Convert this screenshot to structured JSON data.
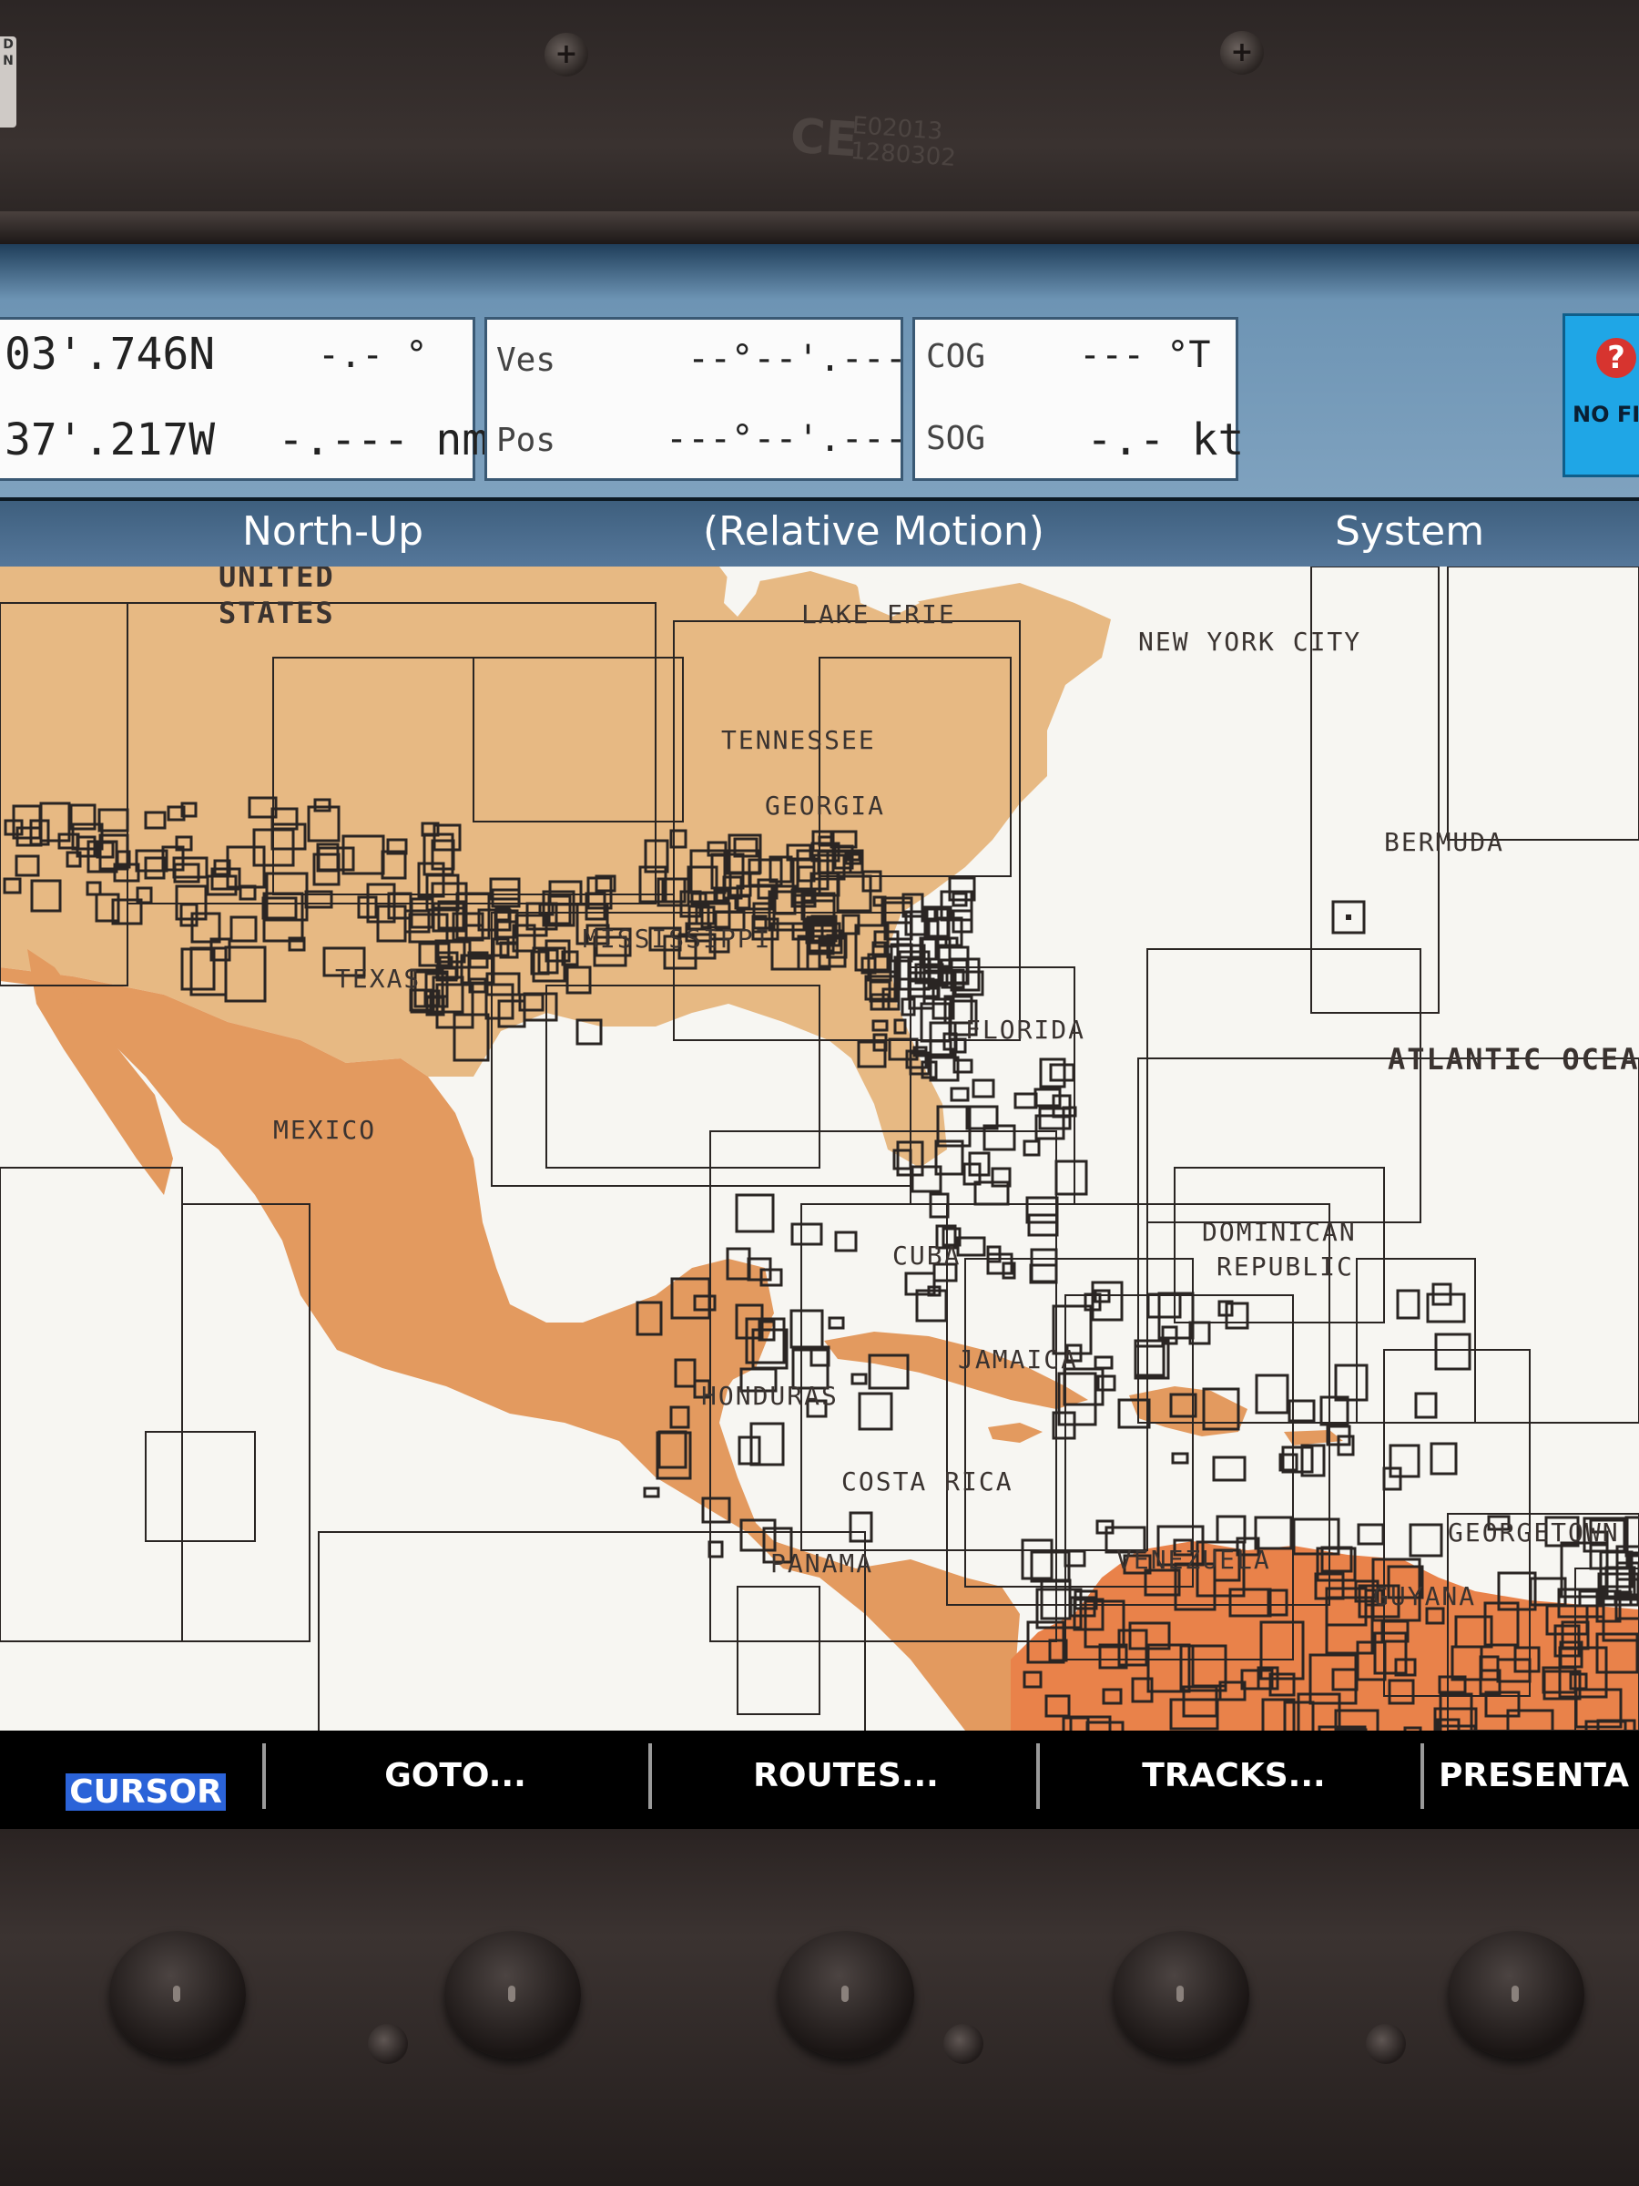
{
  "device": {
    "ce_mark": "CE",
    "ce_code_line1": "E02013",
    "ce_code_line2": "1280302",
    "side_tag": "D N"
  },
  "databar": {
    "latitude": "03'.746N",
    "longitude": "37'.217W",
    "bearing": "-.- °",
    "range": "-.--- nm",
    "ves_label": "Ves",
    "pos_label": "Pos",
    "ves_value": "--°--'.---",
    "pos_value": "---°--'.---",
    "cog_label": "COG",
    "cog_value": "--- °T",
    "sog_label": "SOG",
    "sog_value": "-.- kt",
    "gps_status": "NO FI"
  },
  "modebar": {
    "orientation": "North-Up",
    "motion": "(Relative Motion)",
    "menu": "System"
  },
  "chart": {
    "colors": {
      "land_us": "#e7b983",
      "land_central": "#e39a5f",
      "land_south": "#e9824a",
      "water": "#f7f6f2",
      "grid": "#2a2523"
    },
    "place_labels": [
      "UNITED",
      "STATES",
      "LAKE ERIE",
      "NEW YORK CITY",
      "TENNESSEE",
      "GEORGIA",
      "BERMUDA",
      "MISSISSIPPI",
      "TEXAS",
      "FLORIDA",
      "ATLANTIC OCEAN",
      "MEXICO",
      "DOMINICAN",
      "REPUBLIC",
      "CUBA",
      "JAMAICA",
      "HONDURAS",
      "COSTA RICA",
      "PANAMA",
      "VENEZUELA",
      "GEORGETOWN",
      "GUYANA"
    ]
  },
  "softkeys": {
    "cursor": "CURSOR",
    "goto": "GOTO...",
    "routes": "ROUTES...",
    "tracks": "TRACKS...",
    "presentation": "PRESENTA"
  }
}
